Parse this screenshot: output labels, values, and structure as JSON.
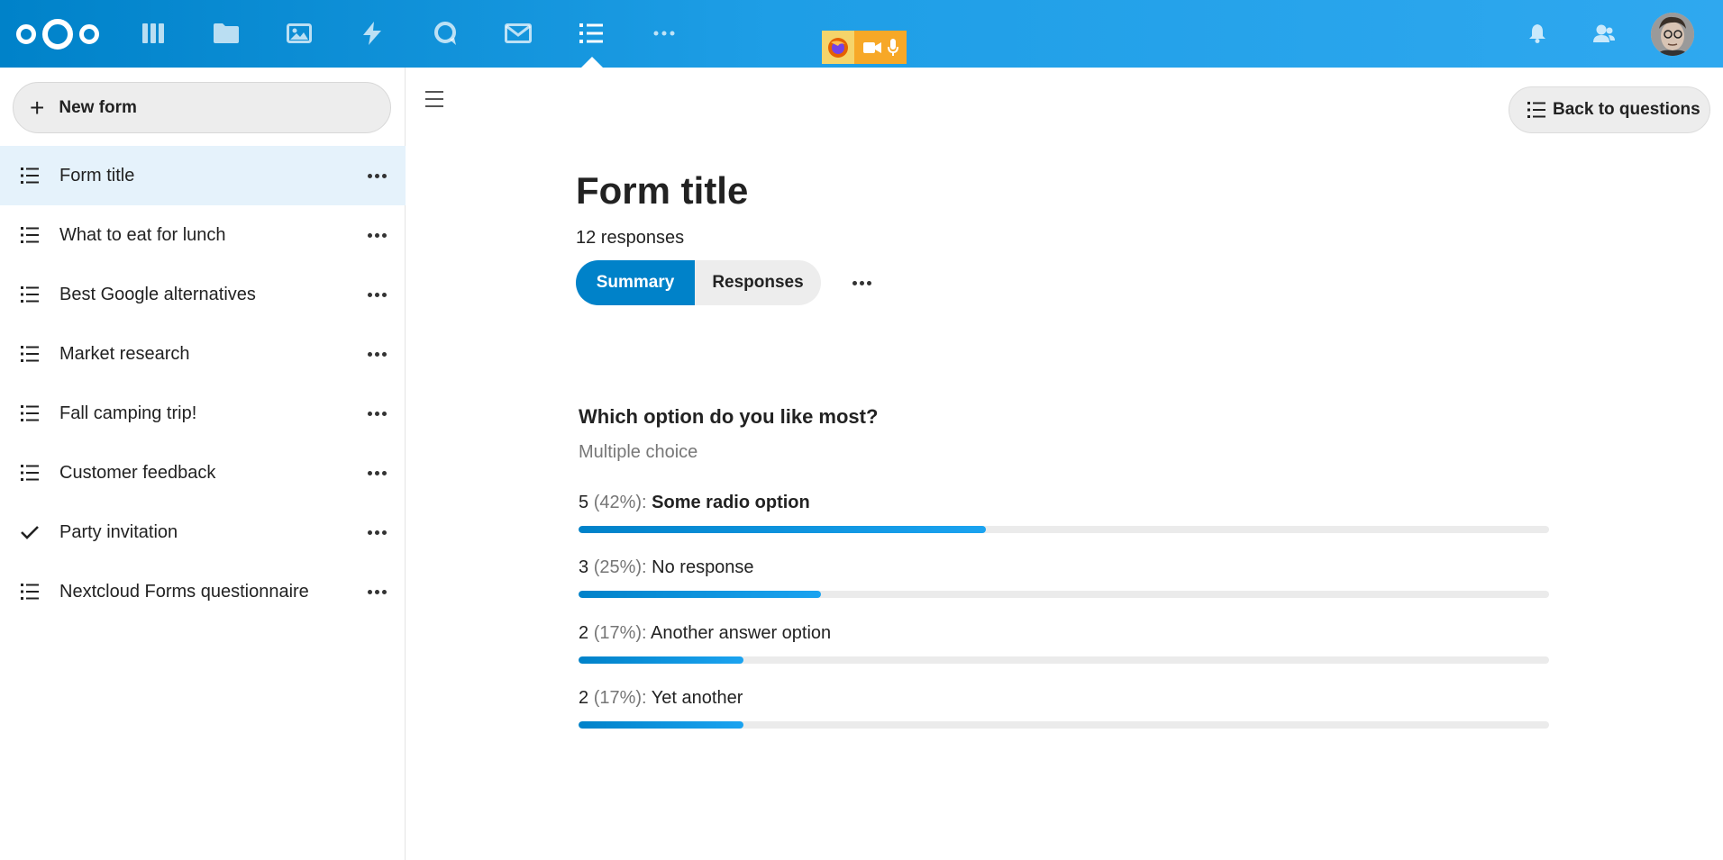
{
  "header": {
    "apps": [
      {
        "name": "dashboard",
        "icon": "dashboard-icon"
      },
      {
        "name": "files",
        "icon": "folder-icon"
      },
      {
        "name": "photos",
        "icon": "image-icon"
      },
      {
        "name": "activity",
        "icon": "lightning-icon"
      },
      {
        "name": "talk",
        "icon": "chat-bubble-icon"
      },
      {
        "name": "mail",
        "icon": "mail-icon"
      },
      {
        "name": "forms",
        "icon": "list-icon",
        "active": true
      },
      {
        "name": "more-apps",
        "icon": "more-horizontal-icon"
      }
    ],
    "accent": "#0082c9"
  },
  "sidebar": {
    "new_form_label": "New form",
    "items": [
      {
        "label": "Form title",
        "icon": "list-icon",
        "active": true
      },
      {
        "label": "What to eat for lunch",
        "icon": "list-icon"
      },
      {
        "label": "Best Google alternatives",
        "icon": "list-icon"
      },
      {
        "label": "Market research",
        "icon": "list-icon"
      },
      {
        "label": "Fall camping trip!",
        "icon": "list-icon"
      },
      {
        "label": "Customer feedback",
        "icon": "list-icon"
      },
      {
        "label": "Party invitation",
        "icon": "checkmark-icon"
      },
      {
        "label": "Nextcloud Forms questionnaire",
        "icon": "list-icon"
      }
    ]
  },
  "main": {
    "back_label": "Back to questions",
    "title": "Form title",
    "response_count": "12 responses",
    "tabs": {
      "summary": "Summary",
      "responses": "Responses"
    },
    "question": {
      "title": "Which option do you like most?",
      "type": "Multiple choice",
      "answers": [
        {
          "count": "5",
          "percent": "(42%):",
          "label": "Some radio option",
          "bold": true,
          "fraction": 0.42
        },
        {
          "count": "3",
          "percent": "(25%):",
          "label": "No response",
          "bold": false,
          "fraction": 0.25
        },
        {
          "count": "2",
          "percent": "(17%):",
          "label": "Another answer option",
          "bold": false,
          "fraction": 0.17
        },
        {
          "count": "2",
          "percent": "(17%):",
          "label": "Yet another",
          "bold": false,
          "fraction": 0.17
        }
      ]
    }
  }
}
